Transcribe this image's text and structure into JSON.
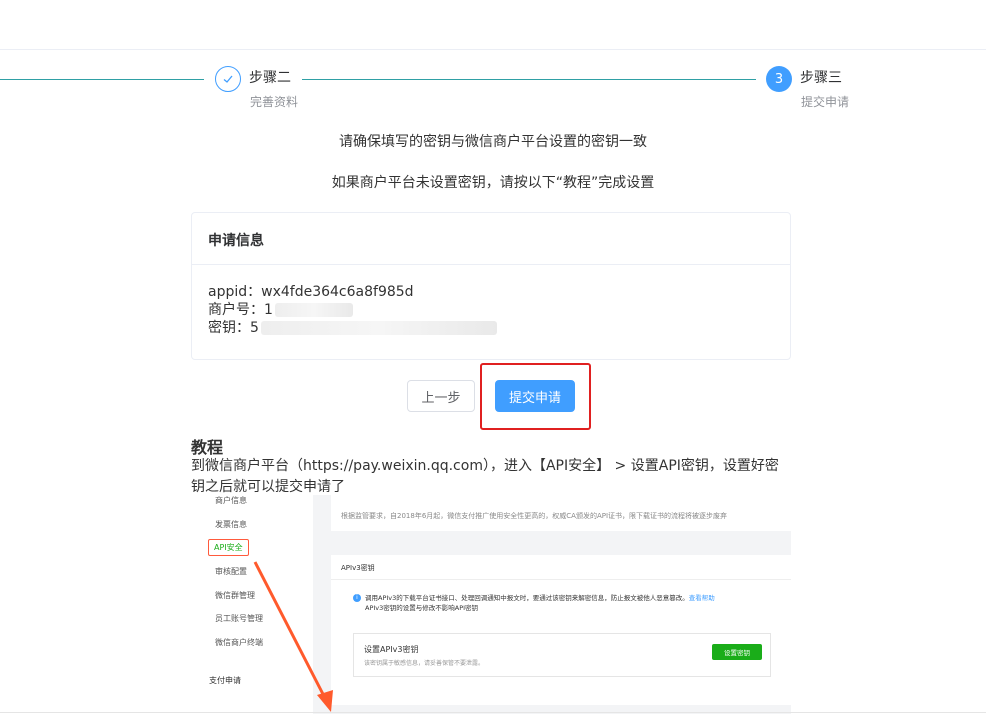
{
  "steps": [
    {
      "title": "步骤二",
      "desc": "完善资料",
      "icon": "check-icon"
    },
    {
      "number": "3",
      "title": "步骤三",
      "desc": "提交申请"
    }
  ],
  "notice": {
    "line1": "请确保填写的密钥与微信商户平台设置的密钥一致",
    "line2": "如果商户平台未设置密钥，请按以下“教程”完成设置"
  },
  "card": {
    "title": "申请信息",
    "appid_label": "appid：",
    "appid_value": "wx4fde364c6a8f985d",
    "merchant_label": "商户号：",
    "merchant_value_visible": "1",
    "key_label": "密钥：",
    "key_value_visible": "5"
  },
  "buttons": {
    "prev": "上一步",
    "submit": "提交申请"
  },
  "tutorial": {
    "title": "教程",
    "text": "到微信商户平台（https://pay.weixin.qq.com），进入【API安全】 > 设置API密钥，设置好密钥之后就可以提交申请了"
  },
  "screenshot": {
    "sidebar": [
      "商户信息",
      "发票信息",
      "API安全",
      "审核配置",
      "微信群管理",
      "员工账号管理",
      "微信商户终端",
      "支付申请"
    ],
    "notice": "根据监管要求，自2018年6月起，微信支付推广使用安全性更高的，权威CA颁发的API证书，限下载证书的流程将被逐步废弃",
    "section_title": "APIv3密钥",
    "info": "调用APIv3的下载平台证书接口、处理回调通知中报文时，要通过该密钥来解密信息，防止报文被他人恶意篡改。",
    "info_link": "查看帮助",
    "info_line2": "APIv3密钥的设置与修改不影响API密钥",
    "box_title": "设置APIv3密钥",
    "box_sub": "该密钥属于敏感信息，请妥善保管不要泄露。",
    "box_button": "设置密钥"
  },
  "colors": {
    "primary": "#409eff",
    "step_line": "#2fa0a5",
    "highlight": "#e02020",
    "arrow": "#ff5a2c",
    "wechat_green": "#1aad19"
  }
}
